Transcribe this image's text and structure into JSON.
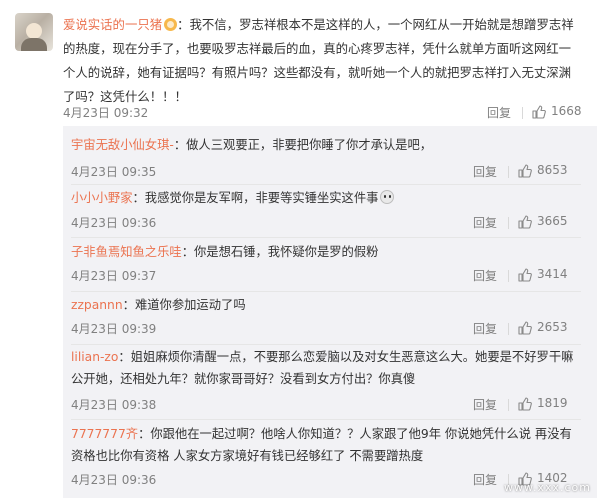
{
  "main_comment": {
    "username": "爱说实话的一只猪",
    "badge_icon": "vip-badge-icon",
    "text": "：我不信，罗志祥根本不是这样的人，一个网红从一开始就是想蹭罗志祥的热度，现在分手了，也要吸罗志祥最后的血，真的心疼罗志祥，凭什么就单方面听这网红一个人的说辞，她有证据吗？有照片吗？这些都没有，就听她一个人的就把罗志祥打入无丈深渊了吗？这凭什么！！！",
    "time": "4月23日 09:32",
    "reply_label": "回复",
    "like_count": "1668"
  },
  "replies": [
    {
      "username": "宇宙无敌小仙女琪-",
      "text": "：做人三观要正，非要把你睡了你才承认是吧，",
      "time": "4月23日 09:35",
      "reply_label": "回复",
      "like_count": "8653"
    },
    {
      "username": "小小小野家",
      "text": "：我感觉你是友军啊，非要等实锤坐实这件事",
      "has_emoji": true,
      "emoji_icon": "sad-face-emoji-icon",
      "time": "4月23日 09:36",
      "reply_label": "回复",
      "like_count": "3665"
    },
    {
      "username": "子非鱼焉知鱼之乐哇",
      "text": "：你是想石锤，我怀疑你是罗的假粉",
      "time": "4月23日 09:37",
      "reply_label": "回复",
      "like_count": "3414"
    },
    {
      "username": "zzpannn",
      "text": "：难道你参加运动了吗",
      "time": "4月23日 09:39",
      "reply_label": "回复",
      "like_count": "2653"
    },
    {
      "username": "lilian-zo",
      "text": "：姐姐麻烦你清醒一点，不要那么恋爱脑以及对女生恶意这么大。她要是不好罗干嘛公开她，还相处九年？就你家哥哥好？没看到女方付出？你真傻",
      "time": "4月23日 09:38",
      "reply_label": "回复",
      "like_count": "1819"
    },
    {
      "username": "7777777齐",
      "text": "：你跟他在一起过啊？他啥人你知道？？人家跟了他9年  你说她凭什么说  再没有资格也比你有资格  人家女方家境好有钱已经够红了  不需要蹭热度",
      "time": "4月23日 09:36",
      "reply_label": "回复",
      "like_count": "1402"
    }
  ],
  "like_icon": "thumbs-up-icon",
  "colors": {
    "username": "#eb7350",
    "reply_bg": "#f2f2f5",
    "meta": "#808080"
  },
  "watermark": "www.xxx.com"
}
